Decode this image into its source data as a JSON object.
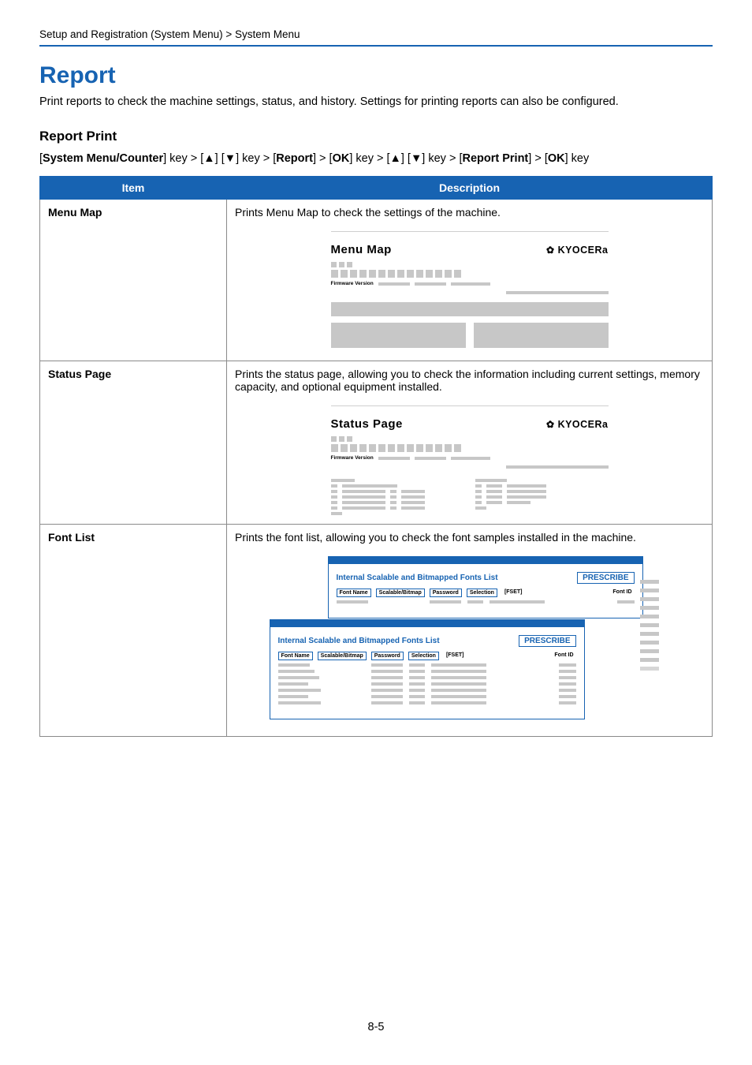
{
  "breadcrumb": "Setup and Registration (System Menu) > System Menu",
  "title": "Report",
  "lead": "Print reports to check the machine settings, status, and history. Settings for printing reports can also be configured.",
  "section_heading": "Report Print",
  "path": {
    "p1": "[",
    "k1": "System Menu/Counter",
    "p2": "] key > [▲] [▼] key > [",
    "k2": "Report",
    "p3": "] > [",
    "k3": "OK",
    "p4": "] key > [▲] [▼] key > [",
    "k4": "Report Print",
    "p5": "] > [",
    "k5": "OK",
    "p6": "] key"
  },
  "table": {
    "head_item": "Item",
    "head_desc": "Description",
    "rows": [
      {
        "item": "Menu Map",
        "desc": "Prints Menu Map to check the settings of the machine.",
        "illus_title": "Menu Map"
      },
      {
        "item": "Status Page",
        "desc": "Prints the status page, allowing you to check the information including current settings, memory capacity, and optional equipment installed.",
        "illus_title": "Status Page"
      },
      {
        "item": "Font List",
        "desc": "Prints the font list, allowing you to check the font samples installed in the machine.",
        "font_title": "Internal Scalable and Bitmapped Fonts List",
        "font_tag": "PRESCRIBE",
        "font_cols": {
          "c1": "Font Name",
          "c2": "Scalable/Bitmap",
          "c3": "Password",
          "c4": "Selection",
          "c5": "[FSET]",
          "c6": "Font ID"
        }
      }
    ]
  },
  "brand": "KYOCERa",
  "firmware_label": "Firmware Version",
  "page_number": "8-5"
}
